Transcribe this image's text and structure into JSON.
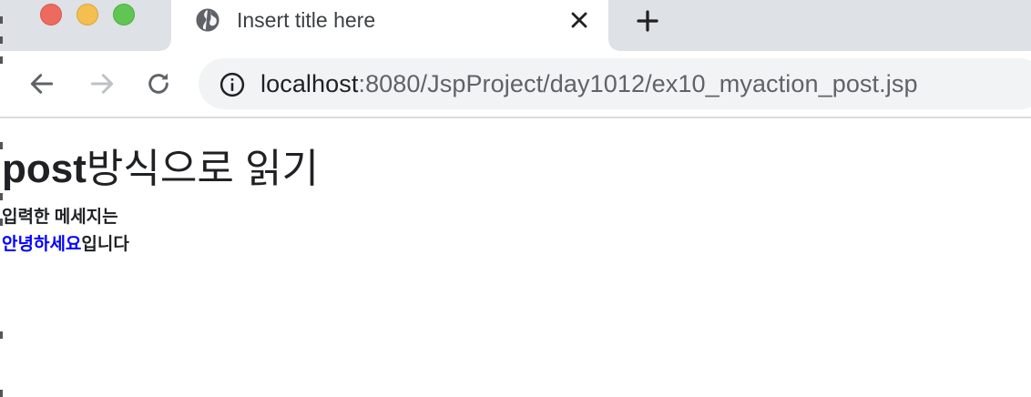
{
  "browser": {
    "tab": {
      "title": "Insert title here",
      "favicon": "globe-icon",
      "close_icon": "close-icon"
    },
    "new_tab_icon": "plus-icon",
    "toolbar": {
      "back_icon": "arrow-left-icon",
      "forward_icon": "arrow-right-icon",
      "reload_icon": "reload-icon",
      "site_info_icon": "info-icon"
    },
    "address": {
      "host": "localhost",
      "rest": ":8080/JspProject/day1012/ex10_myaction_post.jsp"
    }
  },
  "page": {
    "heading_bold": "post",
    "heading_rest": "방식으로 읽기",
    "line1": "입력한 메세지는",
    "message": "안녕하세요",
    "line2_suffix": "입니다"
  },
  "colors": {
    "tabstrip": "#dee1e6",
    "omnibox": "#f1f3f4",
    "message": "#0000ff",
    "traffic_red": "#ed6a5e",
    "traffic_yellow": "#f5bf4f",
    "traffic_green": "#61c554"
  }
}
